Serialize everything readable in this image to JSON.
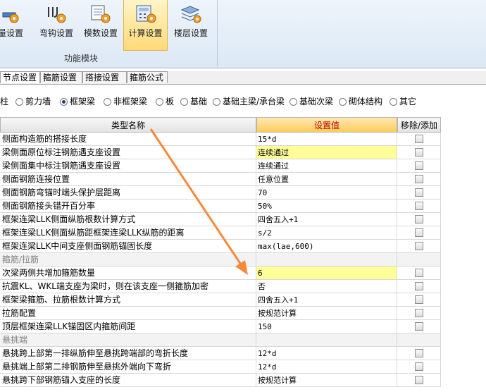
{
  "ribbon": {
    "buttons": [
      {
        "label": "量设置"
      },
      {
        "label": "弯钩设置"
      },
      {
        "label": "模数设置"
      },
      {
        "label": "计算设置"
      },
      {
        "label": "楼层设置"
      }
    ],
    "group_label": "功能模块"
  },
  "tabs": [
    "节点设置",
    "箍筋设置",
    "搭接设置",
    "箍筋公式"
  ],
  "radios": [
    {
      "label": "柱",
      "selected": false
    },
    {
      "label": "剪力墙",
      "selected": false
    },
    {
      "label": "框架梁",
      "selected": true
    },
    {
      "label": "非框架梁",
      "selected": false
    },
    {
      "label": "板",
      "selected": false
    },
    {
      "label": "基础",
      "selected": false
    },
    {
      "label": "基础主梁/承台梁",
      "selected": false
    },
    {
      "label": "基础次梁",
      "selected": false
    },
    {
      "label": "砌体结构",
      "selected": false
    },
    {
      "label": "其它",
      "selected": false
    }
  ],
  "table": {
    "headers": {
      "name": "类型名称",
      "value": "设置值",
      "toggle": "移除/添加"
    },
    "rows": [
      {
        "name": "侧面构造筋的搭接长度",
        "value": "15*d"
      },
      {
        "name": "梁侧面原位标注钢筋遇支座设置",
        "value": "连续通过"
      },
      {
        "name": "梁侧面集中标注钢筋遇支座设置",
        "value": "连续通过"
      },
      {
        "name": "侧面钢筋连接位置",
        "value": "任意位置"
      },
      {
        "name": "侧面钢筋弯锚时端头保护层距离",
        "value": "70"
      },
      {
        "name": "侧面钢筋接头错开百分率",
        "value": "50%"
      },
      {
        "name": "框架连梁LLK侧面纵筋根数计算方式",
        "value": "四舍五入+1"
      },
      {
        "name": "框架连梁LLK侧面纵筋距框架连梁LLK纵筋的距离",
        "value": "s/2"
      },
      {
        "name": "框架连梁LLK中间支座侧面钢筋锚固长度",
        "value": "max(lae,600)"
      },
      {
        "name": "箍筋/拉筋",
        "value": ""
      },
      {
        "name": "次梁两侧共增加箍筋数量",
        "value": "6"
      },
      {
        "name": "抗震KL、WKL端支座为梁时，则在该支座一侧箍筋加密",
        "value": "否"
      },
      {
        "name": "框架梁箍筋、拉筋根数计算方式",
        "value": "四舍五入+1"
      },
      {
        "name": "拉筋配置",
        "value": "按规范计算"
      },
      {
        "name": "顶层框架连梁LLK锚固区内箍筋间距",
        "value": "150"
      },
      {
        "name": "悬挑端",
        "value": ""
      },
      {
        "name": "悬挑跨上部第一排纵筋伸至悬挑跨端部的弯折长度",
        "value": "12*d"
      },
      {
        "name": "悬挑端上部第二排钢筋伸至悬挑外端向下弯折",
        "value": "12*d"
      },
      {
        "name": "悬挑跨下部钢筋锚入支座的长度",
        "value": "按规范计算"
      }
    ]
  },
  "colors": {
    "arrow": "#f58a3c",
    "highlight": "#ffff99",
    "header_value": "#fccb5e"
  }
}
